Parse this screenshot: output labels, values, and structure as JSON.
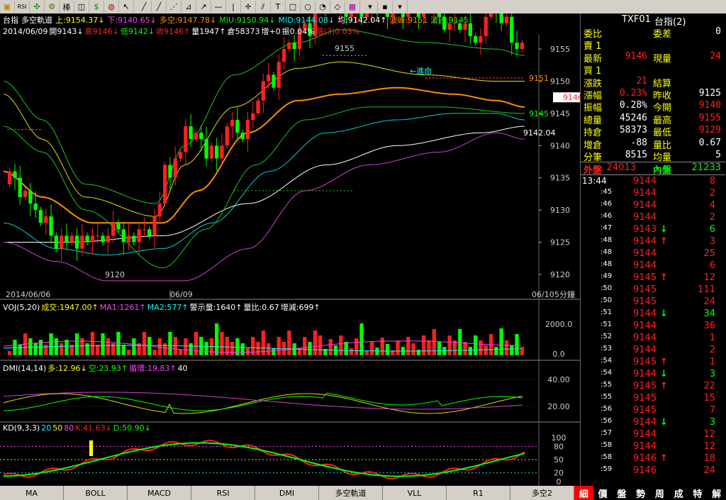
{
  "toolbar": {
    "buttons": [
      {
        "name": "folder-icon",
        "glyph": "▣",
        "color": "#c08000"
      },
      {
        "name": "rsi-button",
        "glyph": "RSI",
        "color": "#000"
      },
      {
        "name": "move-icon",
        "glyph": "✣",
        "color": "#008000"
      },
      {
        "name": "gear-icon",
        "glyph": "⚙",
        "color": "#606000"
      },
      {
        "name": "candle-type-button",
        "glyph": "棒",
        "color": "#000"
      },
      {
        "name": "select-icon",
        "glyph": "◫",
        "color": "#000"
      },
      {
        "name": "dollar-icon",
        "glyph": "$",
        "color": "#008000"
      },
      {
        "name": "color-icon",
        "glyph": "◍",
        "color": "#c00000"
      },
      {
        "name": "pointer-icon",
        "glyph": "↖",
        "color": "#000"
      },
      {
        "name": "line-tool-icon",
        "glyph": "╱",
        "color": "#000"
      },
      {
        "name": "parallel-line-icon",
        "glyph": "╱",
        "color": "#000"
      },
      {
        "name": "fib-icon",
        "glyph": "⋰",
        "color": "#000"
      },
      {
        "name": "measure-icon",
        "glyph": "⊿",
        "color": "#000"
      },
      {
        "name": "arrow-icon",
        "glyph": "↗",
        "color": "#000"
      },
      {
        "name": "hline-icon",
        "glyph": "—",
        "color": "#000"
      },
      {
        "name": "vline-icon",
        "glyph": "|",
        "color": "#000"
      },
      {
        "name": "cross-icon",
        "glyph": "✛",
        "color": "#000"
      },
      {
        "name": "channel-icon",
        "glyph": "⫽",
        "color": "#000"
      },
      {
        "name": "text-icon",
        "glyph": "T",
        "color": "#000"
      },
      {
        "name": "rect-icon",
        "glyph": "□",
        "color": "#000"
      },
      {
        "name": "ellipse-icon",
        "glyph": "○",
        "color": "#000"
      },
      {
        "name": "bucket-icon",
        "glyph": "◔",
        "color": "#000"
      },
      {
        "name": "eraser-icon",
        "glyph": "◇",
        "color": "#000"
      },
      {
        "name": "palette-icon",
        "glyph": "▦",
        "color": "#a000a0"
      },
      {
        "name": "dropdown-icon",
        "glyph": "▾",
        "color": "#000"
      },
      {
        "name": "save-icon",
        "glyph": "▪",
        "color": "#000"
      },
      {
        "name": "dropdown2-icon",
        "glyph": "▾",
        "color": "#000"
      }
    ]
  },
  "main_title": {
    "name": "台指",
    "type": "多空軌道",
    "up": "上:9154.37↓",
    "down": "下:9140.65↓",
    "mid": "多空:9147.78↓",
    "miu": "MIU:9150.94↓",
    "mid2": "MID:9144.08↓",
    "avg": "均:9142.04↑",
    "peak": "波峰:9151",
    "trough": "波谷:9145"
  },
  "main_sub": {
    "date": "2014/06/09",
    "open": "開9143↓",
    "high": "高9146↓",
    "low": "低9142↓",
    "close": "收9146↑",
    "vol": "量1947↑",
    "oi": "倉58373",
    "inc": "增+0",
    "amp": "振0.04%",
    "chg": "漲(3)0.03%"
  },
  "main_yaxis": [
    "9155",
    "9150",
    "9145",
    "9140",
    "9135",
    "9130",
    "9125",
    "9120"
  ],
  "main_annotations": {
    "high_label": "9155",
    "low_label": "9120",
    "arrow_label": "←進命",
    "r1": "9151",
    "r2": "9145",
    "avg_label": "9142.04",
    "price_tag": "9146"
  },
  "main_dates": {
    "d1": "2014/06/06",
    "d2": "06/09",
    "d3": "06/10",
    "period": "5分鐘"
  },
  "vol_title": {
    "name": "VOJ(5,20)",
    "vol": "成交:1947.00↑",
    "ma1": "MA1:1261↑",
    "ma2": "MA2:577↑",
    "warn": "警示量:1640↑",
    "ratio": "量比:0.67",
    "incr": "增減:699↑"
  },
  "vol_yaxis": [
    "2000.0",
    "0.0"
  ],
  "dmi_title": {
    "name": "DMI(14,14)",
    "plus": "多:12.96↓",
    "minus": "空:23.93↑",
    "adx": "循環:19.83↑",
    "level": "40"
  },
  "dmi_yaxis": [
    "40.00",
    "20.00"
  ],
  "kd_title": {
    "name": "KD(9,3,3)",
    "l1": "20",
    "l2": "50",
    "l3": "80",
    "k": "K:41.63↓",
    "d": "D:50.90↓"
  },
  "kd_yaxis": [
    "100",
    "80",
    "50",
    "20",
    "0"
  ],
  "bottom_tabs": [
    "MA",
    "BOLL",
    "MACD",
    "RSI",
    "DMI",
    "多空軌道",
    "VLL",
    "R1",
    "多空2"
  ],
  "right_tabs": [
    "細",
    "價",
    "盤",
    "勢",
    "周",
    "成",
    "特",
    "解"
  ],
  "quote": {
    "symbol": "TXF01",
    "name": "台指(2)",
    "rows": [
      {
        "l1": "委比",
        "v1": "",
        "l2": "委差",
        "v2": "0",
        "c1": "#ffff00",
        "c2": "#ffffff"
      },
      {
        "l1": "賣 1",
        "v1": "",
        "l2": "",
        "v2": "",
        "c1": "#ffff00",
        "c2": "#ffffff"
      },
      {
        "l1": "最新",
        "v1": "9146",
        "l2": "現量",
        "v2": "24",
        "c1": "#ff2020",
        "c2": "#ff2020"
      },
      {
        "l1": "買 1",
        "v1": "",
        "l2": "",
        "v2": "",
        "c1": "#ffff00",
        "c2": "#ffffff"
      },
      {
        "l1": "漲跌",
        "v1": "21",
        "l2": "結算",
        "v2": "",
        "c1": "#ff2020",
        "c2": "#ffffff"
      },
      {
        "l1": "漲幅",
        "v1": "0.23%",
        "l2": "昨收",
        "v2": "9125",
        "c1": "#ff2020",
        "c2": "#ffffff"
      },
      {
        "l1": "振幅",
        "v1": "0.28%",
        "l2": "今開",
        "v2": "9140",
        "c1": "#ffffff",
        "c2": "#ff2020"
      },
      {
        "l1": "總量",
        "v1": "45246",
        "l2": "最高",
        "v2": "9155",
        "c1": "#ffffff",
        "c2": "#ff2020"
      },
      {
        "l1": "持倉",
        "v1": "58373",
        "l2": "最低",
        "v2": "9129",
        "c1": "#ffffff",
        "c2": "#ff2020"
      },
      {
        "l1": "增倉",
        "v1": "-88",
        "l2": "量比",
        "v2": "0.67",
        "c1": "#ffffff",
        "c2": "#ffffff"
      },
      {
        "l1": "分筆",
        "v1": "8515",
        "l2": "均量",
        "v2": "5",
        "c1": "#ffffff",
        "c2": "#ffffff"
      }
    ],
    "outer_label": "外盤",
    "outer": "24013",
    "inner_label": "內盤",
    "inner": "21233"
  },
  "ticks": [
    {
      "t": "13:44",
      "p": "9144",
      "a": "",
      "q": "8"
    },
    {
      "t": ":45",
      "p": "9144",
      "a": "",
      "q": "2"
    },
    {
      "t": ":46",
      "p": "9144",
      "a": "",
      "q": "4"
    },
    {
      "t": ":46",
      "p": "9144",
      "a": "",
      "q": "2"
    },
    {
      "t": ":47",
      "p": "9143",
      "a": "↓",
      "q": "6"
    },
    {
      "t": ":48",
      "p": "9144",
      "a": "↑",
      "q": "3"
    },
    {
      "t": ":48",
      "p": "9144",
      "a": "",
      "q": "25"
    },
    {
      "t": ":48",
      "p": "9144",
      "a": "",
      "q": "6"
    },
    {
      "t": ":49",
      "p": "9145",
      "a": "↑",
      "q": "12"
    },
    {
      "t": ":50",
      "p": "9145",
      "a": "",
      "q": "111"
    },
    {
      "t": ":50",
      "p": "9145",
      "a": "",
      "q": "24"
    },
    {
      "t": ":51",
      "p": "9144",
      "a": "↓",
      "q": "34"
    },
    {
      "t": ":51",
      "p": "9144",
      "a": "",
      "q": "36"
    },
    {
      "t": ":52",
      "p": "9144",
      "a": "",
      "q": "1"
    },
    {
      "t": ":53",
      "p": "9144",
      "a": "",
      "q": "2"
    },
    {
      "t": ":54",
      "p": "9145",
      "a": "↑",
      "q": "1"
    },
    {
      "t": ":54",
      "p": "9144",
      "a": "↓",
      "q": "3"
    },
    {
      "t": ":55",
      "p": "9145",
      "a": "↑",
      "q": "22"
    },
    {
      "t": ":55",
      "p": "9145",
      "a": "",
      "q": "15"
    },
    {
      "t": ":56",
      "p": "9145",
      "a": "",
      "q": "7"
    },
    {
      "t": ":56",
      "p": "9144",
      "a": "↓",
      "q": "3"
    },
    {
      "t": ":57",
      "p": "9144",
      "a": "",
      "q": "12"
    },
    {
      "t": ":58",
      "p": "9144",
      "a": "",
      "q": "12"
    },
    {
      "t": ":58",
      "p": "9146",
      "a": "↑",
      "q": "18"
    },
    {
      "t": ":59",
      "p": "9146",
      "a": "",
      "q": "24"
    }
  ],
  "colors": {
    "up": "#ff2020",
    "down": "#00ff00",
    "ma_orange": "#ff8c00",
    "band_green": "#20c020",
    "cyan": "#00d0d0",
    "magenta": "#d040d0",
    "yellow": "#e0e000",
    "white": "#ffffff"
  }
}
